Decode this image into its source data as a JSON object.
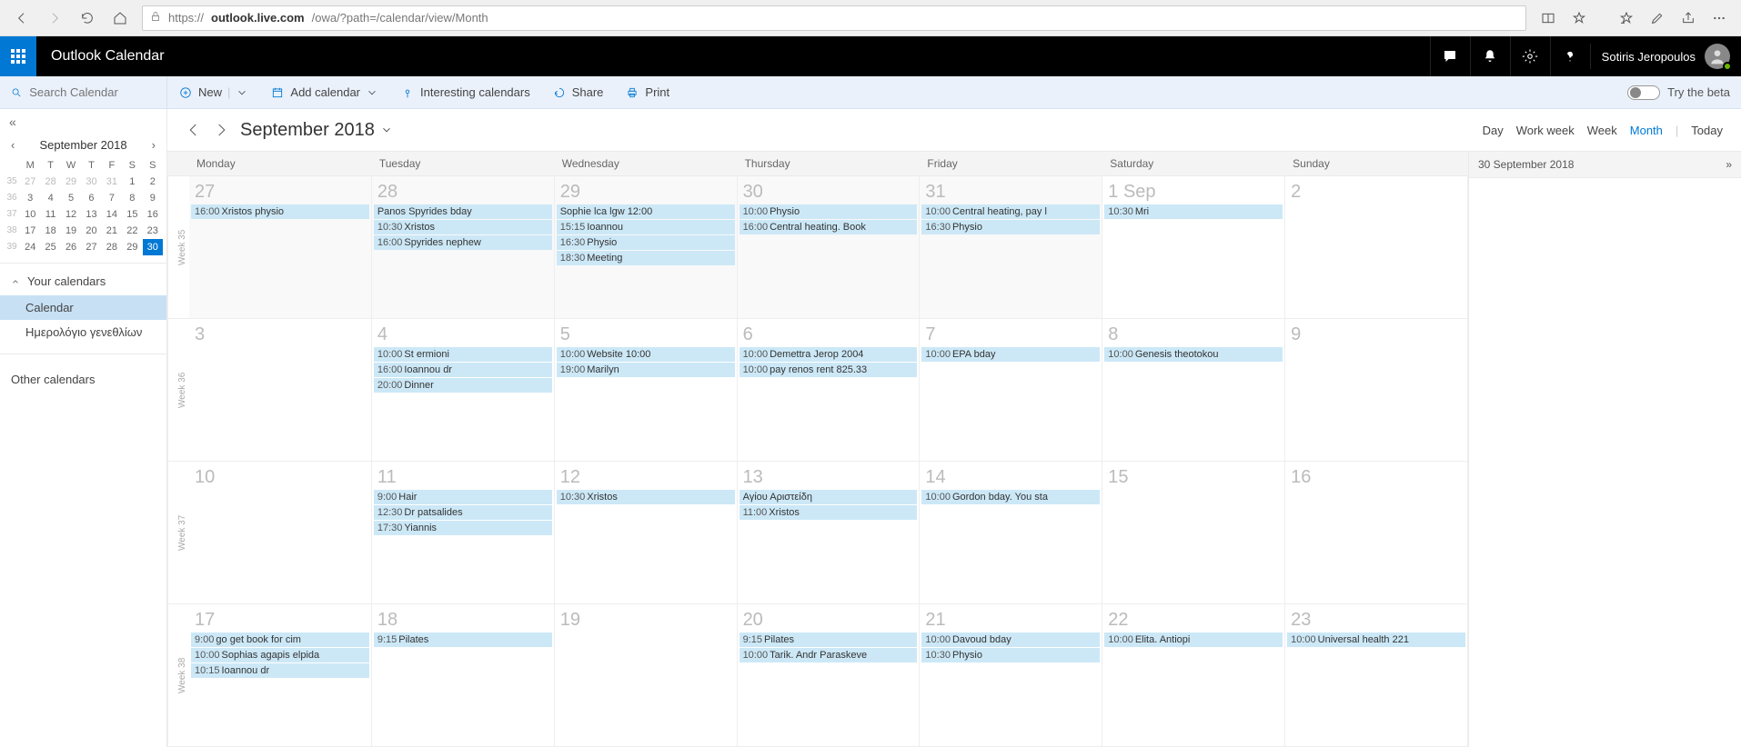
{
  "browser": {
    "url_secure": true,
    "url_domain": "outlook.live.com",
    "url_path": "/owa/?path=/calendar/view/Month",
    "prefix": "https://"
  },
  "header": {
    "app_title": "Outlook Calendar",
    "user_name": "Sotiris Jeropoulos"
  },
  "search": {
    "placeholder": "Search Calendar"
  },
  "commands": {
    "new": "New",
    "add_calendar": "Add calendar",
    "interesting": "Interesting calendars",
    "share": "Share",
    "print": "Print",
    "try_beta": "Try the beta"
  },
  "mini_calendar": {
    "label": "September 2018",
    "day_heads": [
      "M",
      "T",
      "W",
      "T",
      "F",
      "S",
      "S"
    ],
    "rows": [
      {
        "wn": "35",
        "days": [
          "27",
          "28",
          "29",
          "30",
          "31",
          "1",
          "2"
        ],
        "dim": [
          0,
          1,
          2,
          3,
          4
        ]
      },
      {
        "wn": "36",
        "days": [
          "3",
          "4",
          "5",
          "6",
          "7",
          "8",
          "9"
        ],
        "dim": []
      },
      {
        "wn": "37",
        "days": [
          "10",
          "11",
          "12",
          "13",
          "14",
          "15",
          "16"
        ],
        "dim": []
      },
      {
        "wn": "38",
        "days": [
          "17",
          "18",
          "19",
          "20",
          "21",
          "22",
          "23"
        ],
        "dim": []
      },
      {
        "wn": "39",
        "days": [
          "24",
          "25",
          "26",
          "27",
          "28",
          "29",
          "30"
        ],
        "dim": [],
        "sel": 6
      }
    ]
  },
  "left_nav": {
    "your_calendars": "Your calendars",
    "calendar_item": "Calendar",
    "birthday_item": "Ημερολόγιο γενεθλίων",
    "other_calendars": "Other calendars"
  },
  "title": {
    "month": "September 2018"
  },
  "views": {
    "day": "Day",
    "work_week": "Work week",
    "week": "Week",
    "month": "Month",
    "today": "Today"
  },
  "day_headers": [
    "Monday",
    "Tuesday",
    "Wednesday",
    "Thursday",
    "Friday",
    "Saturday",
    "Sunday"
  ],
  "agenda": {
    "date": "30 September 2018"
  },
  "weeks": [
    {
      "label": "Week 35",
      "days": [
        {
          "num": "27",
          "gray": true,
          "events": [
            {
              "t": "16:00",
              "s": "Xristos physio"
            }
          ]
        },
        {
          "num": "28",
          "gray": true,
          "events": [
            {
              "t": "",
              "s": "Panos Spyrides bday"
            },
            {
              "t": "10:30",
              "s": "Xristos"
            },
            {
              "t": "16:00",
              "s": "Spyrides nephew"
            }
          ]
        },
        {
          "num": "29",
          "gray": true,
          "events": [
            {
              "t": "",
              "s": "Sophie lca lgw 12:00"
            },
            {
              "t": "15:15",
              "s": "Ioannou"
            },
            {
              "t": "16:30",
              "s": "Physio"
            },
            {
              "t": "18:30",
              "s": "Meeting"
            }
          ]
        },
        {
          "num": "30",
          "gray": true,
          "events": [
            {
              "t": "10:00",
              "s": "Physio"
            },
            {
              "t": "16:00",
              "s": "Central heating. Book"
            }
          ]
        },
        {
          "num": "31",
          "gray": true,
          "events": [
            {
              "t": "10:00",
              "s": "Central heating, pay l"
            },
            {
              "t": "16:30",
              "s": "Physio"
            }
          ]
        },
        {
          "num": "1 Sep",
          "events": [
            {
              "t": "10:30",
              "s": "Mri"
            }
          ]
        },
        {
          "num": "2",
          "events": []
        }
      ]
    },
    {
      "label": "Week 36",
      "days": [
        {
          "num": "3",
          "events": []
        },
        {
          "num": "4",
          "events": [
            {
              "t": "10:00",
              "s": "St ermioni"
            },
            {
              "t": "16:00",
              "s": "Ioannou dr"
            },
            {
              "t": "20:00",
              "s": "Dinner"
            }
          ]
        },
        {
          "num": "5",
          "events": [
            {
              "t": "10:00",
              "s": "Website 10:00"
            },
            {
              "t": "19:00",
              "s": "Marilyn"
            }
          ]
        },
        {
          "num": "6",
          "events": [
            {
              "t": "10:00",
              "s": "Demettra Jerop 2004"
            },
            {
              "t": "10:00",
              "s": "pay renos rent 825.33"
            }
          ]
        },
        {
          "num": "7",
          "events": [
            {
              "t": "10:00",
              "s": "EPA bday"
            }
          ]
        },
        {
          "num": "8",
          "events": [
            {
              "t": "10:00",
              "s": "Genesis theotokou"
            }
          ]
        },
        {
          "num": "9",
          "events": []
        }
      ]
    },
    {
      "label": "Week 37",
      "days": [
        {
          "num": "10",
          "events": []
        },
        {
          "num": "11",
          "events": [
            {
              "t": "9:00",
              "s": "Hair"
            },
            {
              "t": "12:30",
              "s": "Dr patsalides"
            },
            {
              "t": "17:30",
              "s": "Yiannis"
            }
          ]
        },
        {
          "num": "12",
          "events": [
            {
              "t": "10:30",
              "s": "Xristos"
            }
          ]
        },
        {
          "num": "13",
          "events": [
            {
              "t": "",
              "s": "Αγίου Αριστείδη"
            },
            {
              "t": "11:00",
              "s": "Xristos"
            }
          ]
        },
        {
          "num": "14",
          "events": [
            {
              "t": "10:00",
              "s": "Gordon bday. You sta"
            }
          ]
        },
        {
          "num": "15",
          "events": []
        },
        {
          "num": "16",
          "events": []
        }
      ]
    },
    {
      "label": "Week 38",
      "days": [
        {
          "num": "17",
          "events": [
            {
              "t": "9:00",
              "s": "go get book for cim"
            },
            {
              "t": "10:00",
              "s": "Sophias agapis elpida"
            },
            {
              "t": "10:15",
              "s": "Ioannou dr"
            }
          ]
        },
        {
          "num": "18",
          "events": [
            {
              "t": "9:15",
              "s": "Pilates"
            }
          ]
        },
        {
          "num": "19",
          "events": []
        },
        {
          "num": "20",
          "events": [
            {
              "t": "9:15",
              "s": "Pilates"
            },
            {
              "t": "10:00",
              "s": "Tarik. Andr Paraskeve"
            }
          ]
        },
        {
          "num": "21",
          "events": [
            {
              "t": "10:00",
              "s": "Davoud bday"
            },
            {
              "t": "10:30",
              "s": "Physio"
            }
          ]
        },
        {
          "num": "22",
          "events": [
            {
              "t": "10:00",
              "s": "Elita. Antiopi"
            }
          ]
        },
        {
          "num": "23",
          "events": [
            {
              "t": "10:00",
              "s": "Universal health 221"
            }
          ]
        }
      ]
    }
  ]
}
